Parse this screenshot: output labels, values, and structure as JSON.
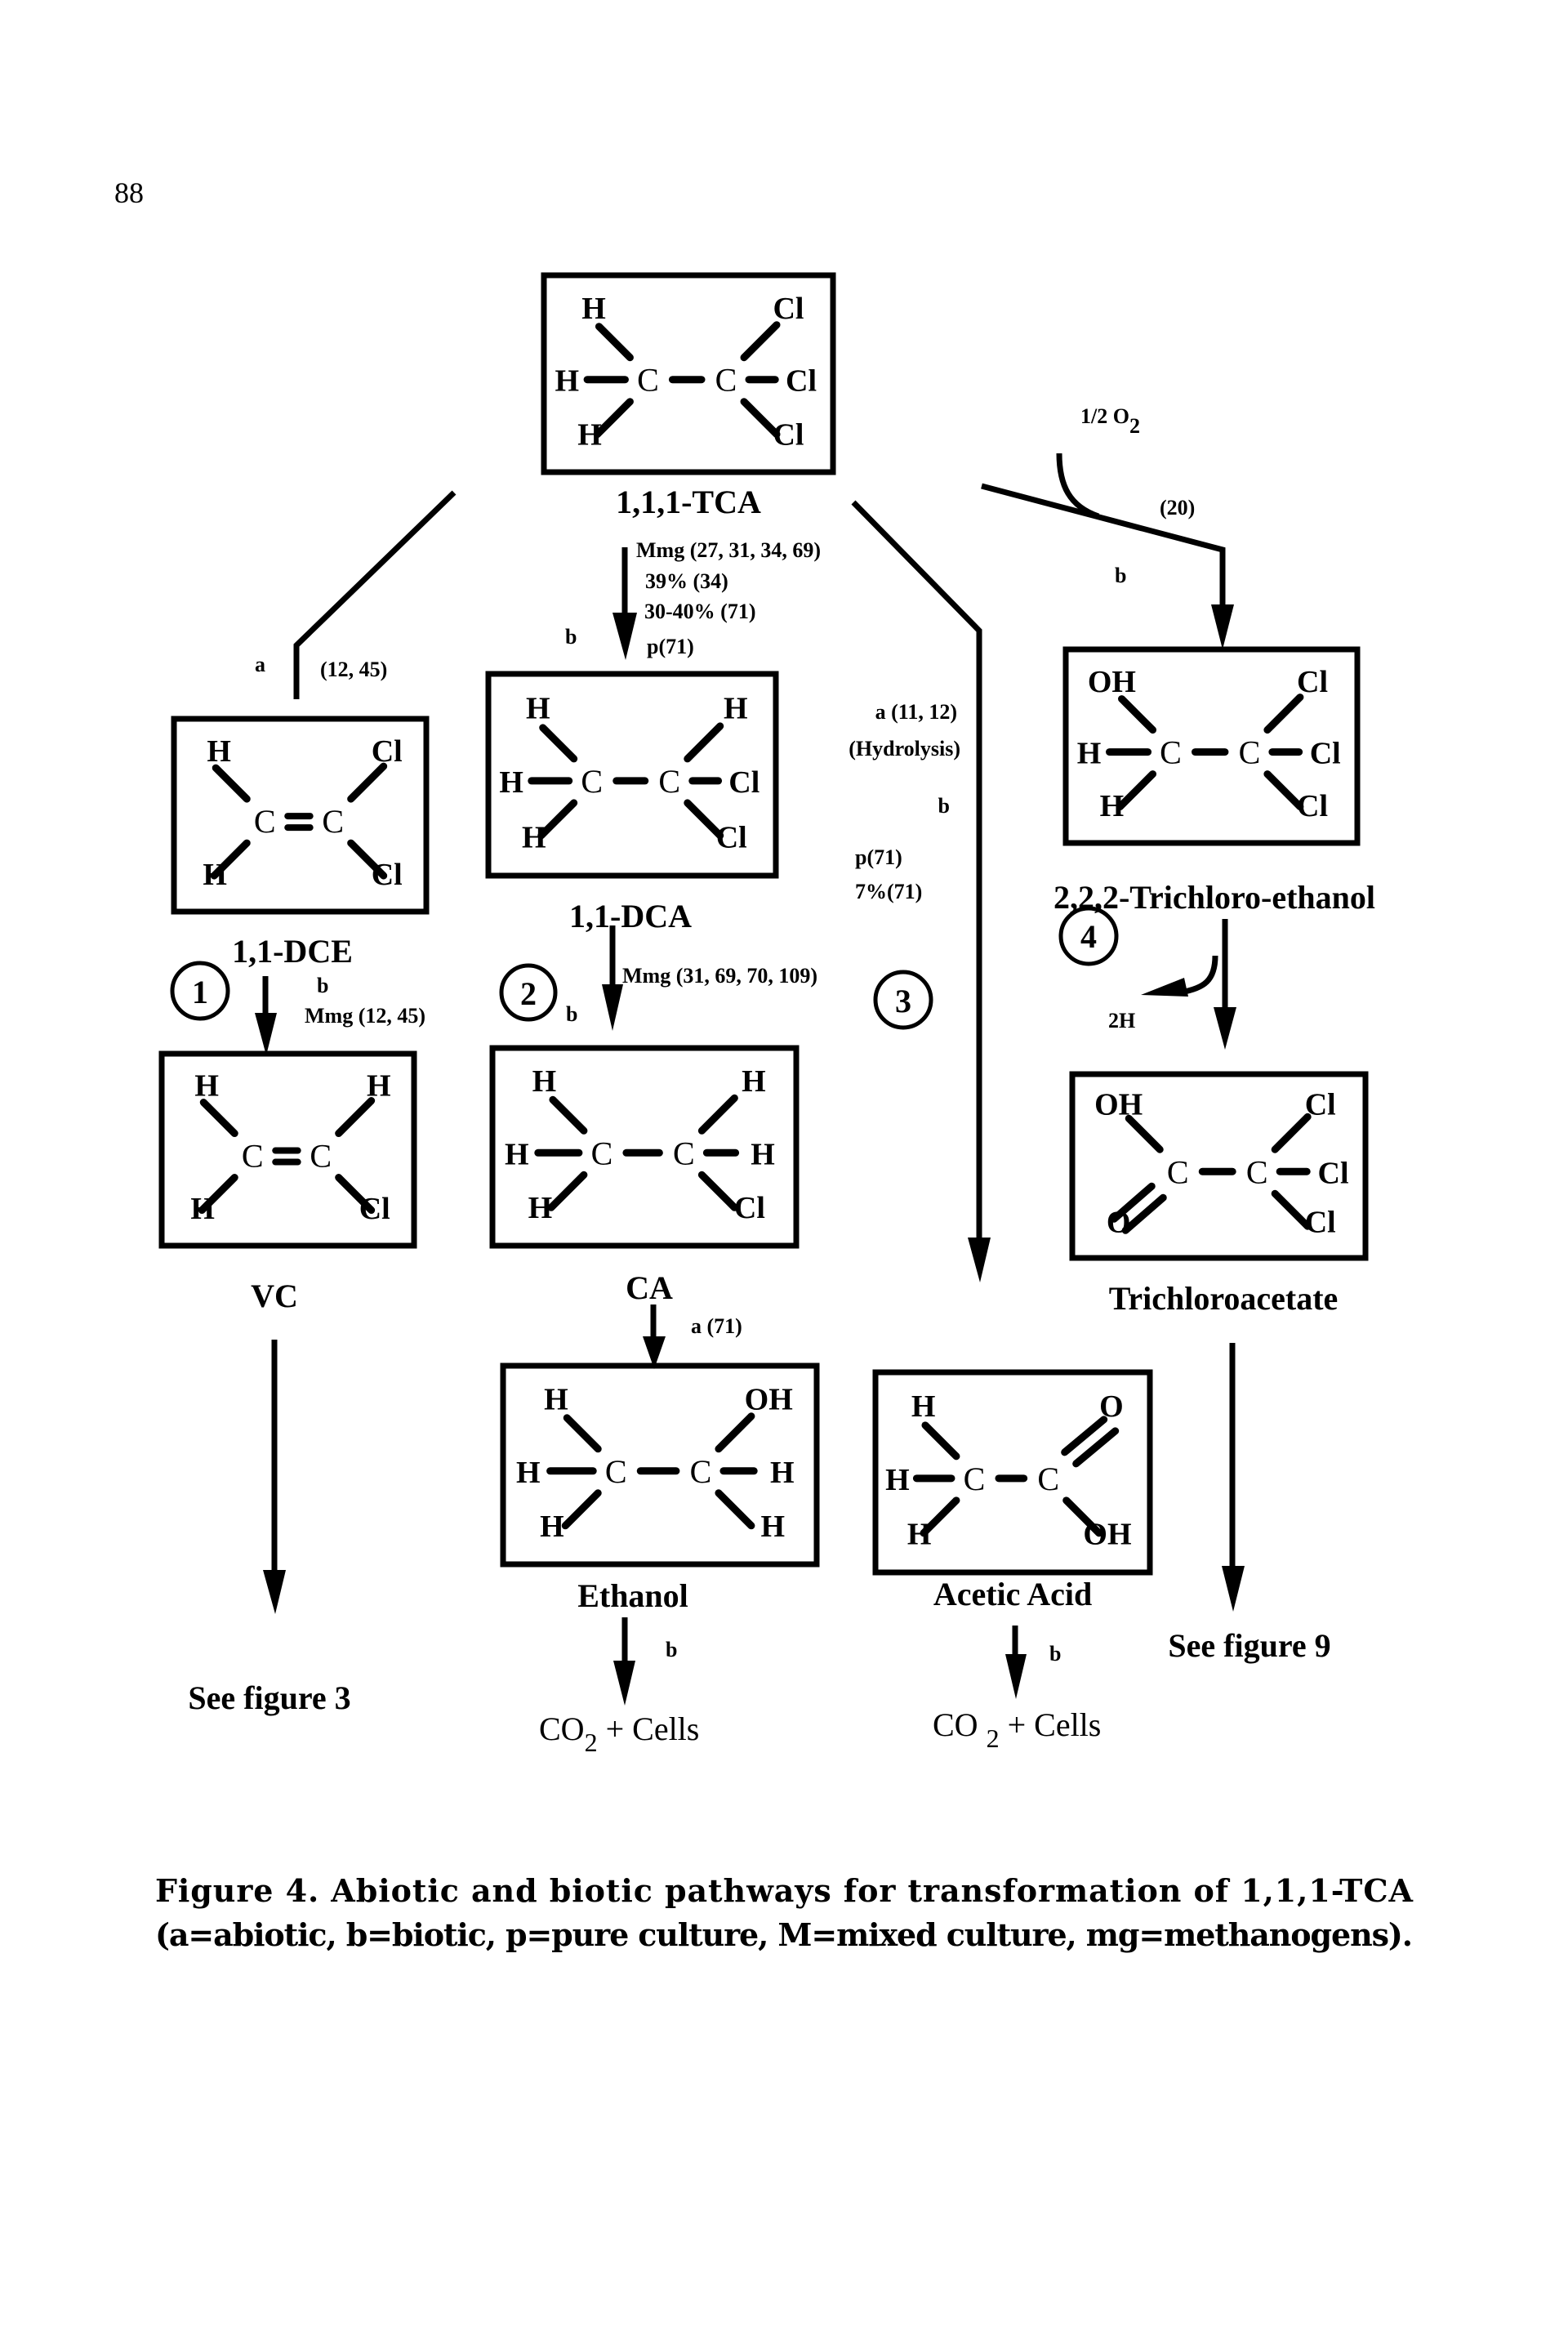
{
  "page_number": "88",
  "molecules": {
    "tca": {
      "name": "1,1,1-TCA",
      "atoms": {
        "l_top": "H",
        "l_mid": "H",
        "l_bot": "H",
        "c1": "C",
        "c2": "C",
        "r_top": "Cl",
        "r_mid": "Cl",
        "r_bot": "Cl"
      }
    },
    "dce": {
      "name": "1,1-DCE",
      "atoms": {
        "l_top": "H",
        "l_bot": "H",
        "c1": "C",
        "c2": "C",
        "r_top": "Cl",
        "r_bot": "Cl"
      }
    },
    "vc": {
      "name": "VC",
      "atoms": {
        "l_top": "H",
        "l_bot": "H",
        "c1": "C",
        "c2": "C",
        "r_top": "H",
        "r_bot": "Cl"
      }
    },
    "dca": {
      "name": "1,1-DCA",
      "atoms": {
        "l_top": "H",
        "l_mid": "H",
        "l_bot": "H",
        "c1": "C",
        "c2": "C",
        "r_top": "H",
        "r_mid": "Cl",
        "r_bot": "Cl"
      }
    },
    "ca": {
      "name": "CA",
      "atoms": {
        "l_top": "H",
        "l_mid": "H",
        "l_bot": "H",
        "c1": "C",
        "c2": "C",
        "r_top": "H",
        "r_mid": "H",
        "r_bot": "Cl"
      }
    },
    "ethanol": {
      "name": "Ethanol",
      "atoms": {
        "l_top": "H",
        "l_mid": "H",
        "l_bot": "H",
        "c1": "C",
        "c2": "C",
        "r_top": "OH",
        "r_mid": "H",
        "r_bot": "H"
      }
    },
    "acetic_acid": {
      "name": "Acetic Acid",
      "atoms": {
        "l_top": "H",
        "l_mid": "H",
        "l_bot": "H",
        "c1": "C",
        "c2": "C",
        "r_top": "O",
        "r_bot": "OH"
      }
    },
    "trichloroethanol": {
      "name": "2,2,2-Trichloro-ethanol",
      "atoms": {
        "l_top": "OH",
        "l_mid": "H",
        "l_bot": "H",
        "c1": "C",
        "c2": "C",
        "r_top": "Cl",
        "r_mid": "Cl",
        "r_bot": "Cl"
      }
    },
    "trichloroacetate": {
      "name": "Trichloroacetate",
      "atoms": {
        "l_top": "OH",
        "l_bot": "O",
        "c1": "C",
        "c2": "C",
        "r_top": "Cl",
        "r_mid": "Cl",
        "r_bot": "Cl"
      }
    }
  },
  "pathways": {
    "p1_circle": "1",
    "p2_circle": "2",
    "p3_circle": "3",
    "p4_circle": "4",
    "tca_to_dce": {
      "type": "a",
      "refs": "(12, 45)"
    },
    "dce_to_vc": {
      "type": "b",
      "note": "Mmg (12, 45)"
    },
    "vc_out": {
      "target": "See figure 3"
    },
    "tca_to_dca": {
      "type": "b",
      "lines": [
        "Mmg (27, 31, 34, 69)",
        "39% (34)",
        "30-40% (71)",
        "p(71)"
      ]
    },
    "dca_to_ca": {
      "type": "b",
      "note": "Mmg (31, 69, 70, 109)"
    },
    "ca_to_ethanol": {
      "note": "a (71)"
    },
    "ethanol_out": {
      "type": "b",
      "product": "CO",
      "sub": "2",
      "rest": " + Cells"
    },
    "tca_to_acetic": {
      "lines": [
        "a (11, 12)",
        "(Hydrolysis)",
        "b",
        "p(71)",
        "7%(71)"
      ]
    },
    "acetic_out": {
      "type": "b",
      "product": "CO ",
      "sub": "2",
      "rest": " + Cells"
    },
    "tca_to_tce": {
      "type": "b",
      "ref": "(20)",
      "cofactor": "1/2 O",
      "cofactor_sub": "2"
    },
    "tce_to_tca_acid": {
      "byproduct": "2H"
    },
    "tcaa_out": {
      "target": "See figure 9"
    }
  },
  "caption": {
    "line1": "Figure 4.  Abiotic and biotic pathways for transformation of 1,1,1-TCA",
    "line2": "(a=abiotic, b=biotic, p=pure culture, M=mixed culture, mg=methanogens)."
  }
}
